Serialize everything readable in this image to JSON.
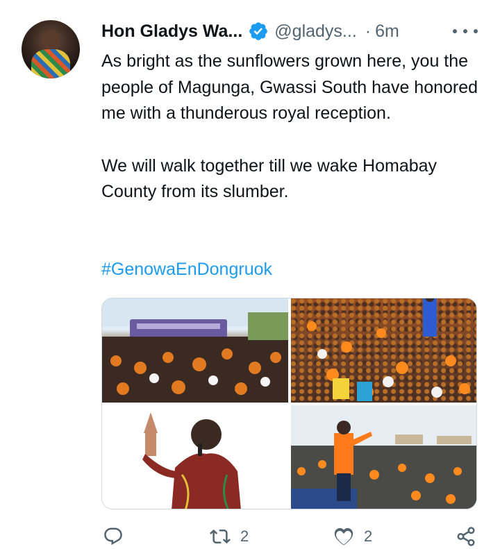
{
  "tweet": {
    "author_name": "Hon Gladys Wa...",
    "handle": "@gladys...",
    "separator": "·",
    "time": "6m",
    "text_para1": "As bright as the sunflowers grown here, you the people of Magunga, Gwassi South have honored me with a thunderous royal reception.",
    "text_para2": "We will walk together till we wake Homabay County from its slumber.",
    "hashtag": "#GenowaEnDongruok",
    "photos": [
      "rally-crowd-bus",
      "rally-crowd-aerial",
      "speaker-raised-hand",
      "speaker-on-stage-crowd"
    ]
  },
  "actions": {
    "reply_count": "",
    "retweet_count": "2",
    "like_count": "2"
  },
  "icons": {
    "verified": "verified-badge-icon",
    "more": "more-icon",
    "reply": "reply-icon",
    "retweet": "retweet-icon",
    "like": "like-icon",
    "share": "share-icon"
  },
  "colors": {
    "text": "#0f1419",
    "secondary": "#536471",
    "link": "#1d9bf0",
    "verified": "#1d9bf0"
  }
}
